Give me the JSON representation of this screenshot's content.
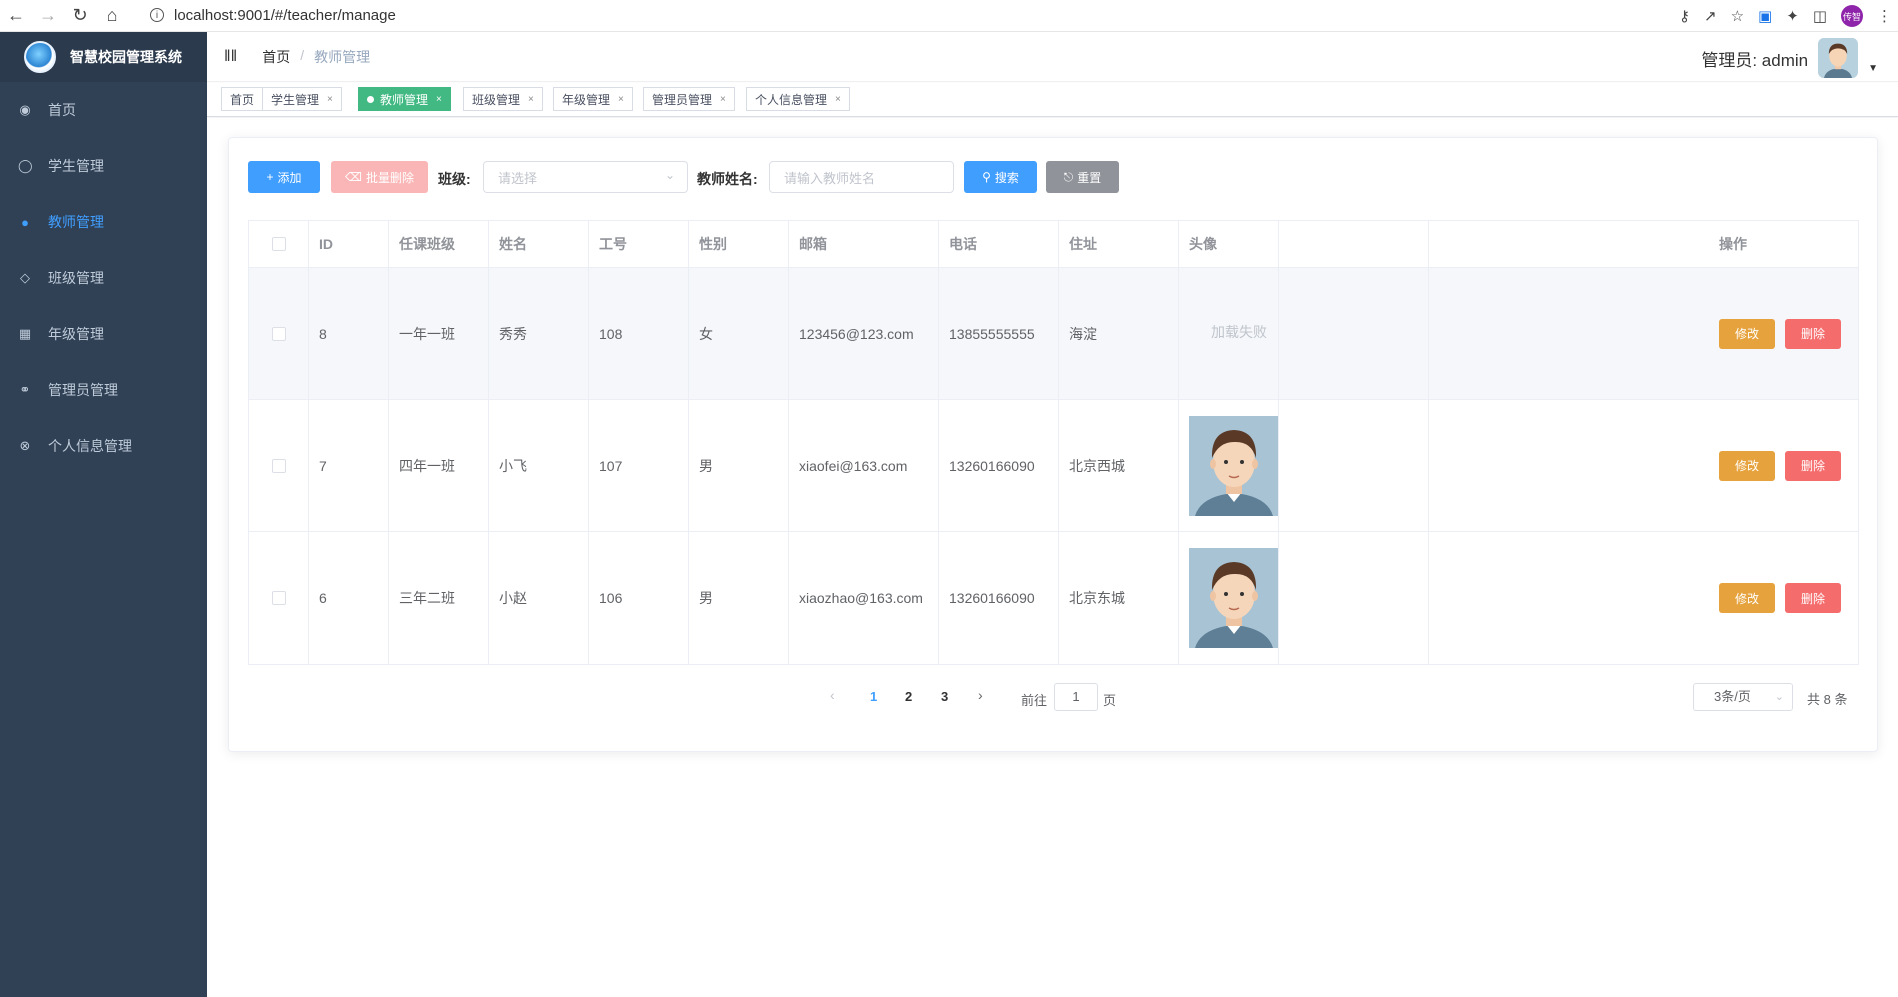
{
  "browser": {
    "url": "localhost:9001/#/teacher/manage",
    "profile_badge": "传智"
  },
  "sidebar": {
    "brand_title": "智慧校园管理系统",
    "items": [
      {
        "label": "首页",
        "icon": "dashboard-icon"
      },
      {
        "label": "学生管理",
        "icon": "user-icon"
      },
      {
        "label": "教师管理",
        "icon": "teacher-icon",
        "active": true
      },
      {
        "label": "班级管理",
        "icon": "tag-icon"
      },
      {
        "label": "年级管理",
        "icon": "calendar-icon"
      },
      {
        "label": "管理员管理",
        "icon": "admin-icon"
      },
      {
        "label": "个人信息管理",
        "icon": "profile-icon"
      }
    ]
  },
  "header": {
    "breadcrumb_home": "首页",
    "breadcrumb_sep": "/",
    "breadcrumb_current": "教师管理",
    "user_label": "管理员: admin"
  },
  "tags": [
    {
      "label": "首页",
      "closable": false
    },
    {
      "label": "学生管理",
      "closable": true
    },
    {
      "label": "教师管理",
      "closable": true,
      "active": true
    },
    {
      "label": "班级管理",
      "closable": true
    },
    {
      "label": "年级管理",
      "closable": true
    },
    {
      "label": "管理员管理",
      "closable": true
    },
    {
      "label": "个人信息管理",
      "closable": true
    }
  ],
  "toolbar": {
    "add_label": "添加",
    "batch_delete_label": "批量删除",
    "class_label": "班级:",
    "class_placeholder": "请选择",
    "name_label": "教师姓名:",
    "name_placeholder": "请输入教师姓名",
    "search_label": "搜索",
    "reset_label": "重置"
  },
  "table": {
    "columns": [
      "ID",
      "任课班级",
      "姓名",
      "工号",
      "性别",
      "邮箱",
      "电话",
      "住址",
      "头像",
      "操作"
    ],
    "edit_label": "修改",
    "delete_label": "删除",
    "rows": [
      {
        "id": "8",
        "class": "一年一班",
        "name": "秀秀",
        "number": "108",
        "gender": "女",
        "email": "123456@123.com",
        "phone": "13855555555",
        "address": "海淀",
        "avatar": "加载失败"
      },
      {
        "id": "7",
        "class": "四年一班",
        "name": "小飞",
        "number": "107",
        "gender": "男",
        "email": "xiaofei@163.com",
        "phone": "13260166090",
        "address": "北京西城",
        "avatar": "photo"
      },
      {
        "id": "6",
        "class": "三年二班",
        "name": "小赵",
        "number": "106",
        "gender": "男",
        "email": "xiaozhao@163.com",
        "phone": "13260166090",
        "address": "北京东城",
        "avatar": "photo"
      }
    ]
  },
  "pagination": {
    "pages": [
      "1",
      "2",
      "3"
    ],
    "current": "1",
    "goto_prefix": "前往",
    "goto_value": "1",
    "goto_suffix": "页",
    "page_size": "3条/页",
    "total": "共 8 条"
  }
}
